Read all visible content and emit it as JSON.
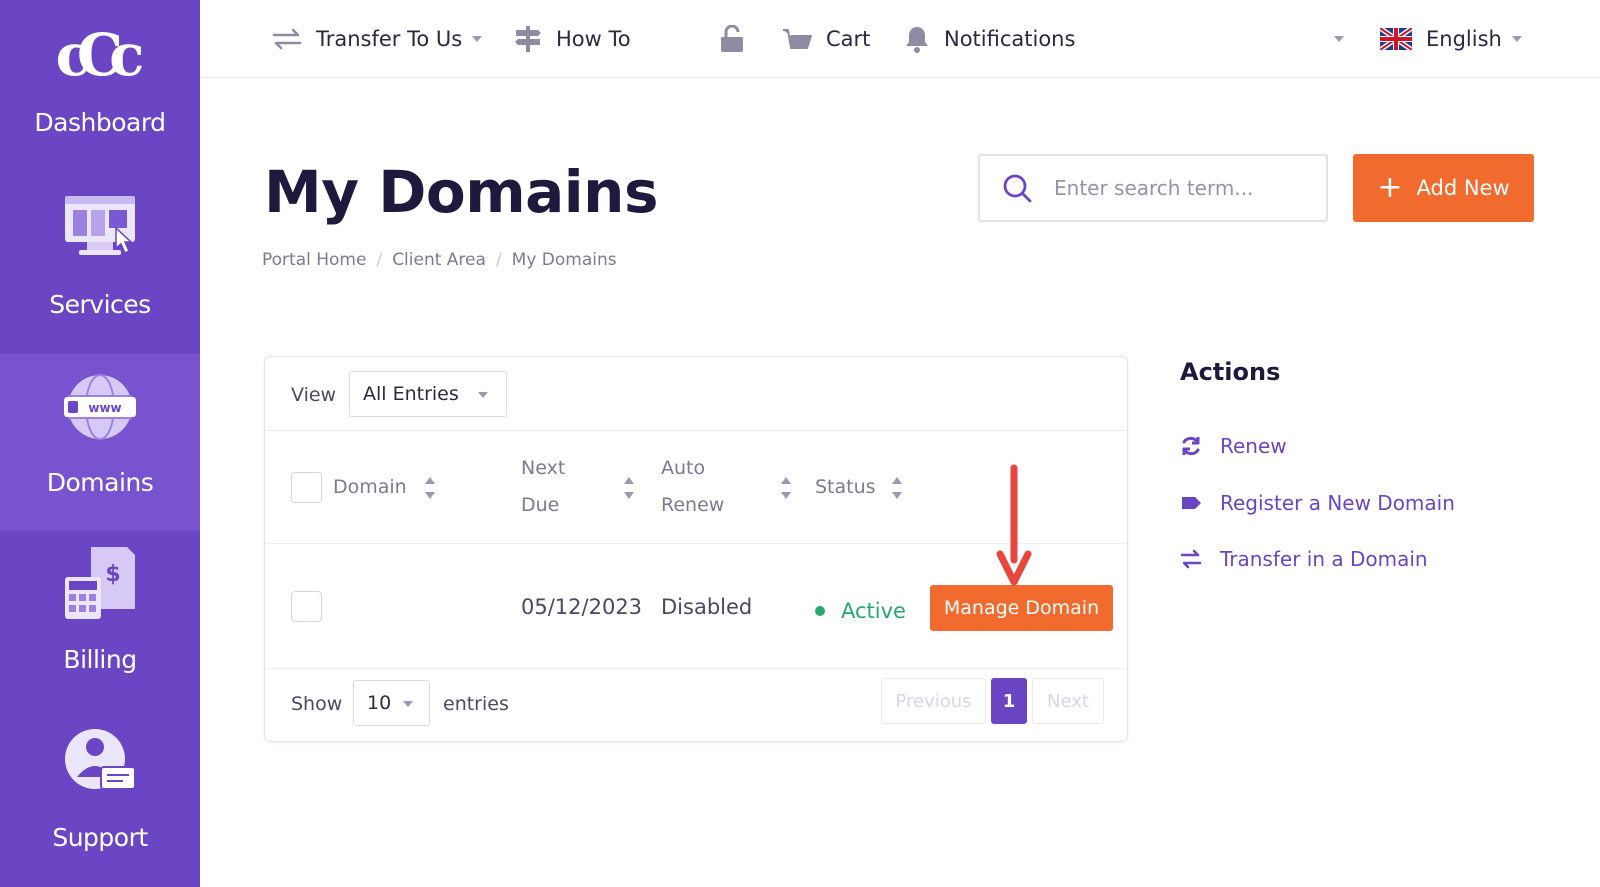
{
  "sidebar": {
    "logo_mark": "cCc",
    "items": [
      {
        "label": "Dashboard"
      },
      {
        "label": "Services"
      },
      {
        "label": "Domains"
      },
      {
        "label": "Billing"
      },
      {
        "label": "Support"
      }
    ],
    "active": "Domains",
    "colors": {
      "background": "#6a45c4",
      "active": "#7753cf"
    }
  },
  "topbar": {
    "transfer": "Transfer To Us",
    "howto": "How To",
    "cart": "Cart",
    "notifications": "Notifications",
    "language": "English"
  },
  "page": {
    "title": "My Domains",
    "breadcrumb": [
      "Portal Home",
      "Client Area",
      "My Domains"
    ],
    "breadcrumb_separator": "/",
    "search_placeholder": "Enter search term...",
    "add_new": "Add New"
  },
  "table": {
    "view_label": "View",
    "view_value": "All Entries",
    "columns": {
      "domain": "Domain",
      "next_due": [
        "Next",
        "Due"
      ],
      "auto_renew": [
        "Auto",
        "Renew"
      ],
      "status": "Status"
    },
    "rows": [
      {
        "domain": "",
        "next_due": "05/12/2023",
        "auto_renew": "Disabled",
        "status": "Active",
        "action": "Manage Domain"
      }
    ],
    "show_label": "Show",
    "page_length": "10",
    "entries_label": "entries",
    "pagination": {
      "previous": "Previous",
      "current": "1",
      "next": "Next"
    }
  },
  "actions": {
    "title": "Actions",
    "items": [
      {
        "label": "Renew",
        "icon": "refresh-icon"
      },
      {
        "label": "Register a New Domain",
        "icon": "tag-icon"
      },
      {
        "label": "Transfer in a Domain",
        "icon": "transfer-icon"
      }
    ]
  },
  "colors": {
    "accent": "#f26b2e",
    "brand": "#6a45c4",
    "success": "#28a86a"
  }
}
